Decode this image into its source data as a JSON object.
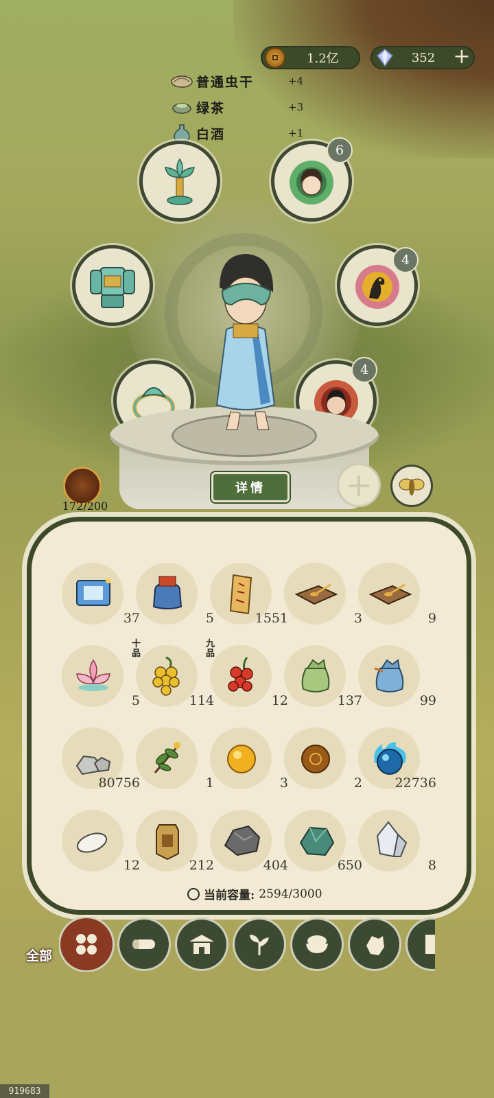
{
  "currency": {
    "coins": {
      "icon": "copper-coin-icon",
      "value": "1.2亿"
    },
    "gems": {
      "icon": "crystal-gem-icon",
      "value": "352",
      "add_label": "+"
    }
  },
  "buffs": [
    {
      "icon": "dried-insect-icon",
      "name": "普通虫干",
      "value": "+4"
    },
    {
      "icon": "green-tea-icon",
      "name": "绿茶",
      "value": "+3"
    },
    {
      "icon": "liquor-bottle-icon",
      "name": "白酒",
      "value": "+1"
    }
  ],
  "equipment": {
    "lotus_cup": {
      "icon": "lotus-cup-icon"
    },
    "maiden_portrait": {
      "icon": "maiden-portrait-icon",
      "badge": "6"
    },
    "armor": {
      "icon": "jade-armor-icon"
    },
    "phoenix_portrait": {
      "icon": "phoenix-portrait-icon",
      "badge": "4"
    },
    "jade_ring": {
      "icon": "jade-ring-icon"
    },
    "warrior_portrait": {
      "icon": "warrior-portrait-icon",
      "badge": "4"
    }
  },
  "character": {
    "details_label": "详情"
  },
  "pet": {
    "icon": "fire-beast-icon",
    "count": "172/200"
  },
  "slots": {
    "add_label": "+",
    "moth_icon": "golden-moth-icon"
  },
  "inventory": [
    {
      "icon": "scroll-box-icon",
      "count": "37",
      "grade": ""
    },
    {
      "icon": "treasure-bag-icon",
      "count": "5",
      "grade": ""
    },
    {
      "icon": "talisman-paper-icon",
      "count": "1551",
      "grade": ""
    },
    {
      "icon": "spoon-tray-icon",
      "count": "3",
      "grade": ""
    },
    {
      "icon": "spoon-tray-icon",
      "count": "9",
      "grade": ""
    },
    {
      "icon": "lotus-flower-icon",
      "count": "5",
      "grade": ""
    },
    {
      "icon": "golden-berry-icon",
      "count": "114",
      "grade": "十品"
    },
    {
      "icon": "red-berry-icon",
      "count": "12",
      "grade": "九品"
    },
    {
      "icon": "green-pouch-icon",
      "count": "137",
      "grade": ""
    },
    {
      "icon": "blue-pouch-icon",
      "count": "99",
      "grade": ""
    },
    {
      "icon": "stone-pile-icon",
      "count": "80756",
      "grade": ""
    },
    {
      "icon": "herb-sprig-icon",
      "count": "1",
      "grade": ""
    },
    {
      "icon": "golden-pill-icon",
      "count": "3",
      "grade": ""
    },
    {
      "icon": "bronze-pill-icon",
      "count": "2",
      "grade": ""
    },
    {
      "icon": "blue-spirit-orb-icon",
      "count": "22736",
      "grade": ""
    },
    {
      "icon": "white-grain-icon",
      "count": "12",
      "grade": ""
    },
    {
      "icon": "gold-token-icon",
      "count": "212",
      "grade": ""
    },
    {
      "icon": "iron-ore-icon",
      "count": "404",
      "grade": ""
    },
    {
      "icon": "jade-ore-icon",
      "count": "650",
      "grade": ""
    },
    {
      "icon": "crystal-shard-icon",
      "count": "8",
      "grade": ""
    }
  ],
  "capacity": {
    "label": "当前容量:",
    "value": "2594/3000"
  },
  "tabs": [
    {
      "icon": "all-grid-icon",
      "label": "全部",
      "active": true
    },
    {
      "icon": "wood-log-icon"
    },
    {
      "icon": "house-icon"
    },
    {
      "icon": "leaf-sprout-icon"
    },
    {
      "icon": "rice-bowl-icon"
    },
    {
      "icon": "ore-chunk-icon"
    },
    {
      "icon": "scroll-icon"
    }
  ],
  "uid": "919683",
  "colors": {
    "panel_border": "#3d4a2a",
    "panel_bg": "#f2ead5",
    "details_button": "#4e6e3b",
    "active_tab": "#8a3a22",
    "tab": "#3c4a34"
  }
}
